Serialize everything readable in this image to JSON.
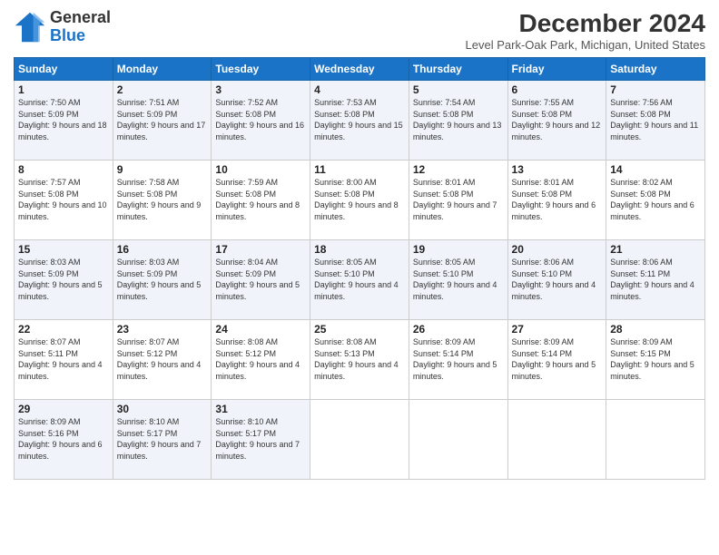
{
  "header": {
    "logo_line1": "General",
    "logo_line2": "Blue",
    "title": "December 2024",
    "location": "Level Park-Oak Park, Michigan, United States"
  },
  "weekdays": [
    "Sunday",
    "Monday",
    "Tuesday",
    "Wednesday",
    "Thursday",
    "Friday",
    "Saturday"
  ],
  "weeks": [
    [
      {
        "day": "1",
        "sunrise": "7:50 AM",
        "sunset": "5:09 PM",
        "daylight": "9 hours and 18 minutes."
      },
      {
        "day": "2",
        "sunrise": "7:51 AM",
        "sunset": "5:09 PM",
        "daylight": "9 hours and 17 minutes."
      },
      {
        "day": "3",
        "sunrise": "7:52 AM",
        "sunset": "5:08 PM",
        "daylight": "9 hours and 16 minutes."
      },
      {
        "day": "4",
        "sunrise": "7:53 AM",
        "sunset": "5:08 PM",
        "daylight": "9 hours and 15 minutes."
      },
      {
        "day": "5",
        "sunrise": "7:54 AM",
        "sunset": "5:08 PM",
        "daylight": "9 hours and 13 minutes."
      },
      {
        "day": "6",
        "sunrise": "7:55 AM",
        "sunset": "5:08 PM",
        "daylight": "9 hours and 12 minutes."
      },
      {
        "day": "7",
        "sunrise": "7:56 AM",
        "sunset": "5:08 PM",
        "daylight": "9 hours and 11 minutes."
      }
    ],
    [
      {
        "day": "8",
        "sunrise": "7:57 AM",
        "sunset": "5:08 PM",
        "daylight": "9 hours and 10 minutes."
      },
      {
        "day": "9",
        "sunrise": "7:58 AM",
        "sunset": "5:08 PM",
        "daylight": "9 hours and 9 minutes."
      },
      {
        "day": "10",
        "sunrise": "7:59 AM",
        "sunset": "5:08 PM",
        "daylight": "9 hours and 8 minutes."
      },
      {
        "day": "11",
        "sunrise": "8:00 AM",
        "sunset": "5:08 PM",
        "daylight": "9 hours and 8 minutes."
      },
      {
        "day": "12",
        "sunrise": "8:01 AM",
        "sunset": "5:08 PM",
        "daylight": "9 hours and 7 minutes."
      },
      {
        "day": "13",
        "sunrise": "8:01 AM",
        "sunset": "5:08 PM",
        "daylight": "9 hours and 6 minutes."
      },
      {
        "day": "14",
        "sunrise": "8:02 AM",
        "sunset": "5:08 PM",
        "daylight": "9 hours and 6 minutes."
      }
    ],
    [
      {
        "day": "15",
        "sunrise": "8:03 AM",
        "sunset": "5:09 PM",
        "daylight": "9 hours and 5 minutes."
      },
      {
        "day": "16",
        "sunrise": "8:03 AM",
        "sunset": "5:09 PM",
        "daylight": "9 hours and 5 minutes."
      },
      {
        "day": "17",
        "sunrise": "8:04 AM",
        "sunset": "5:09 PM",
        "daylight": "9 hours and 5 minutes."
      },
      {
        "day": "18",
        "sunrise": "8:05 AM",
        "sunset": "5:10 PM",
        "daylight": "9 hours and 4 minutes."
      },
      {
        "day": "19",
        "sunrise": "8:05 AM",
        "sunset": "5:10 PM",
        "daylight": "9 hours and 4 minutes."
      },
      {
        "day": "20",
        "sunrise": "8:06 AM",
        "sunset": "5:10 PM",
        "daylight": "9 hours and 4 minutes."
      },
      {
        "day": "21",
        "sunrise": "8:06 AM",
        "sunset": "5:11 PM",
        "daylight": "9 hours and 4 minutes."
      }
    ],
    [
      {
        "day": "22",
        "sunrise": "8:07 AM",
        "sunset": "5:11 PM",
        "daylight": "9 hours and 4 minutes."
      },
      {
        "day": "23",
        "sunrise": "8:07 AM",
        "sunset": "5:12 PM",
        "daylight": "9 hours and 4 minutes."
      },
      {
        "day": "24",
        "sunrise": "8:08 AM",
        "sunset": "5:12 PM",
        "daylight": "9 hours and 4 minutes."
      },
      {
        "day": "25",
        "sunrise": "8:08 AM",
        "sunset": "5:13 PM",
        "daylight": "9 hours and 4 minutes."
      },
      {
        "day": "26",
        "sunrise": "8:09 AM",
        "sunset": "5:14 PM",
        "daylight": "9 hours and 5 minutes."
      },
      {
        "day": "27",
        "sunrise": "8:09 AM",
        "sunset": "5:14 PM",
        "daylight": "9 hours and 5 minutes."
      },
      {
        "day": "28",
        "sunrise": "8:09 AM",
        "sunset": "5:15 PM",
        "daylight": "9 hours and 5 minutes."
      }
    ],
    [
      {
        "day": "29",
        "sunrise": "8:09 AM",
        "sunset": "5:16 PM",
        "daylight": "9 hours and 6 minutes."
      },
      {
        "day": "30",
        "sunrise": "8:10 AM",
        "sunset": "5:17 PM",
        "daylight": "9 hours and 7 minutes."
      },
      {
        "day": "31",
        "sunrise": "8:10 AM",
        "sunset": "5:17 PM",
        "daylight": "9 hours and 7 minutes."
      },
      null,
      null,
      null,
      null
    ]
  ]
}
